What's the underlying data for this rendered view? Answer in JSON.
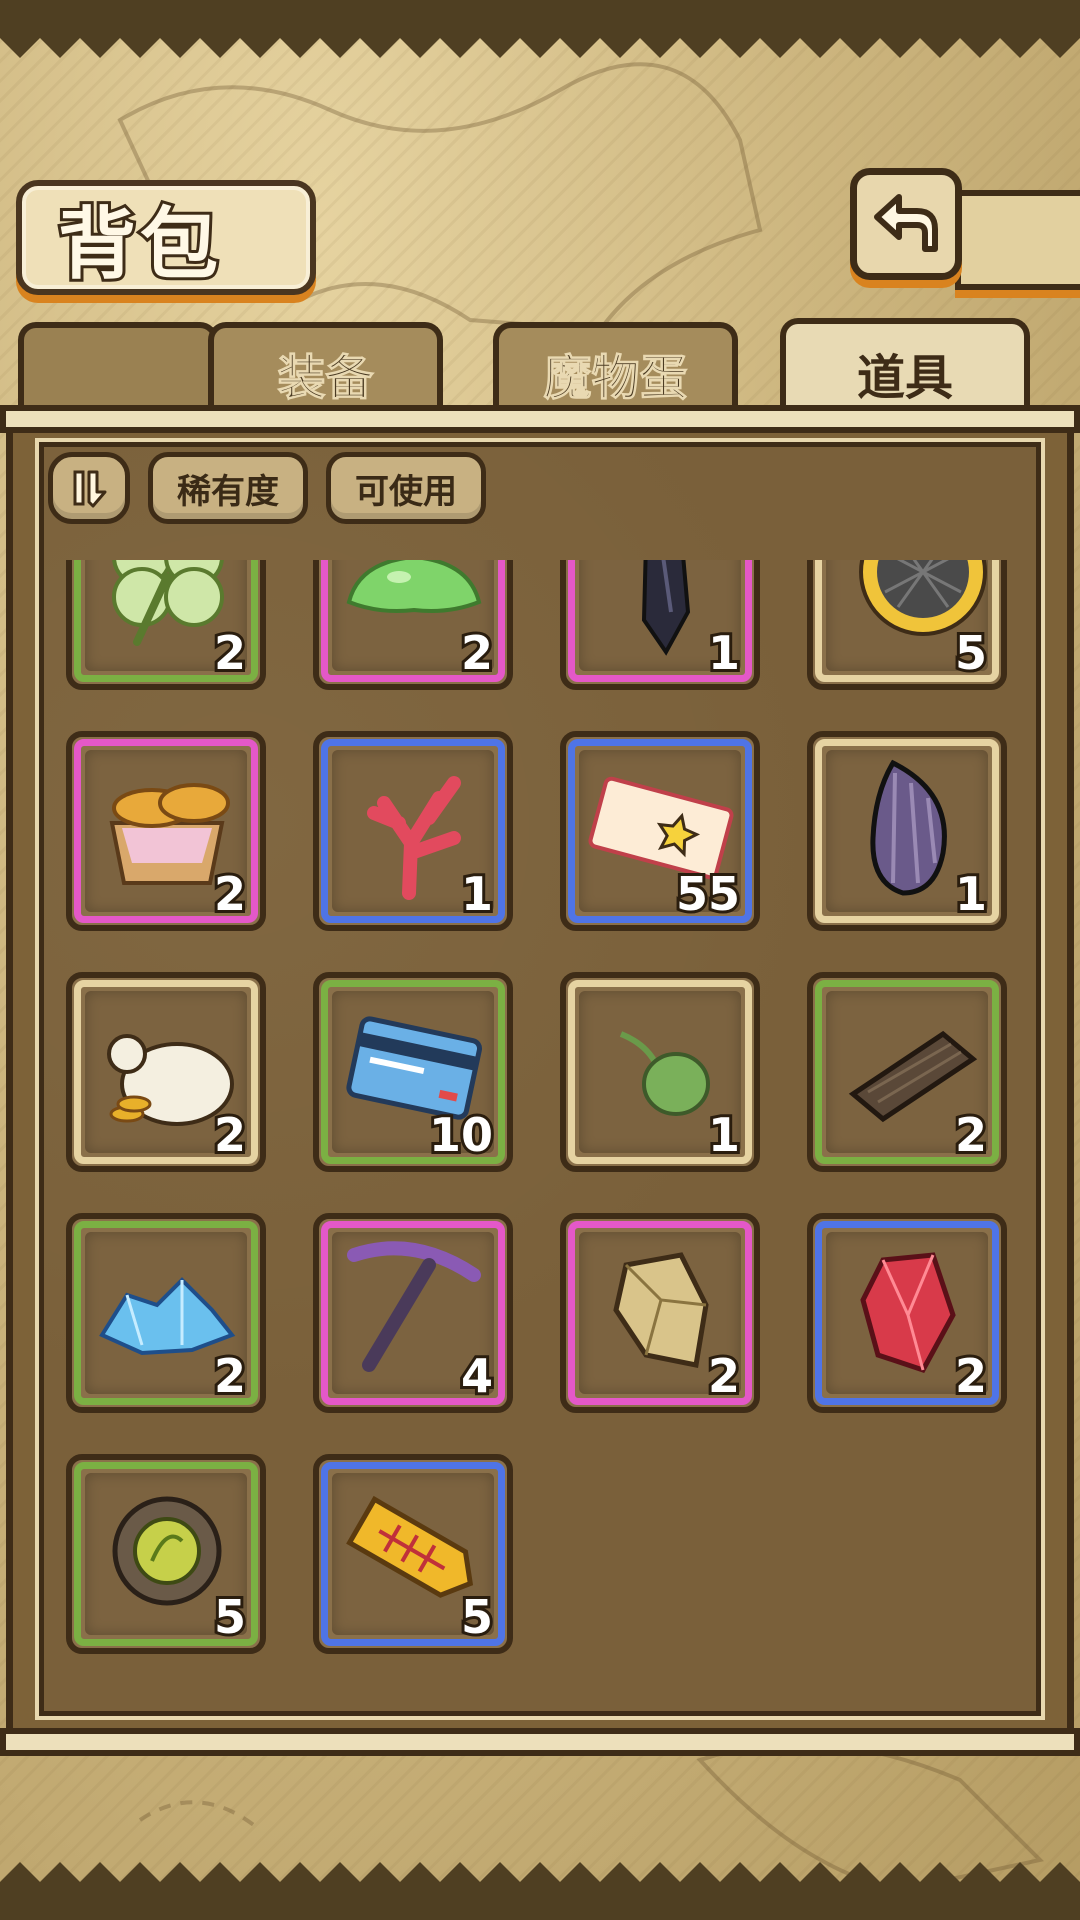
{
  "header": {
    "title": "背包"
  },
  "tabs": [
    {
      "label": "装备",
      "active": false
    },
    {
      "label": "魔物蛋",
      "active": false
    },
    {
      "label": "道具",
      "active": true
    }
  ],
  "filters": {
    "sort_icon": "sort-icon",
    "rarity_label": "稀有度",
    "usable_label": "可使用"
  },
  "rarity_colors": {
    "common": "#e6d3a2",
    "green": "#7bb043",
    "blue": "#4f74e6",
    "purple": "#e458c8"
  },
  "items": [
    {
      "name": "four-leaf-clover",
      "count": "2",
      "rarity": "green"
    },
    {
      "name": "green-slime",
      "count": "2",
      "rarity": "purple"
    },
    {
      "name": "dark-crystal",
      "count": "1",
      "rarity": "purple"
    },
    {
      "name": "melon-bread",
      "count": "5",
      "rarity": "common"
    },
    {
      "name": "bread-basket",
      "count": "2",
      "rarity": "purple"
    },
    {
      "name": "red-coral",
      "count": "1",
      "rarity": "blue"
    },
    {
      "name": "star-ticket",
      "count": "55",
      "rarity": "blue"
    },
    {
      "name": "sunflower-seed",
      "count": "1",
      "rarity": "common"
    },
    {
      "name": "coin-sack",
      "count": "2",
      "rarity": "common"
    },
    {
      "name": "blue-card",
      "count": "10",
      "rarity": "green"
    },
    {
      "name": "green-seed",
      "count": "1",
      "rarity": "common"
    },
    {
      "name": "wood-plank",
      "count": "2",
      "rarity": "green"
    },
    {
      "name": "ice-crystals",
      "count": "2",
      "rarity": "green"
    },
    {
      "name": "pickaxe",
      "count": "4",
      "rarity": "purple"
    },
    {
      "name": "gold-ore",
      "count": "2",
      "rarity": "purple"
    },
    {
      "name": "ruby-crystal",
      "count": "2",
      "rarity": "blue"
    },
    {
      "name": "turtle-badge",
      "count": "5",
      "rarity": "green"
    },
    {
      "name": "fishbone-tag",
      "count": "5",
      "rarity": "blue"
    }
  ]
}
